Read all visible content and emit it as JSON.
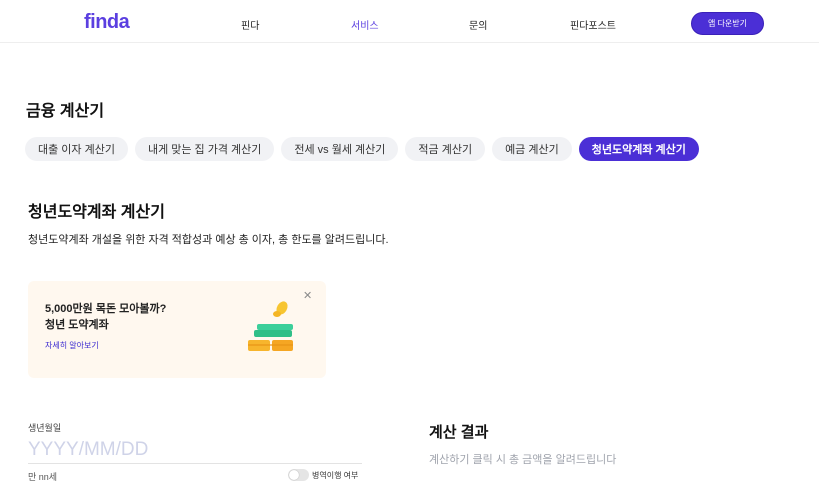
{
  "header": {
    "logo": "finda",
    "nav": [
      "핀다",
      "서비스",
      "문의",
      "핀다포스트"
    ],
    "active_nav": "서비스",
    "app_button": "앱 다운받기",
    "accent_color": "#4b2fd6"
  },
  "page": {
    "section_title": "금융 계산기",
    "chips": [
      {
        "label": "대출 이자 계산기",
        "active": false
      },
      {
        "label": "내게 맞는 집 가격 계산기",
        "active": false
      },
      {
        "label": "전세 vs 월세 계산기",
        "active": false
      },
      {
        "label": "적금 계산기",
        "active": false
      },
      {
        "label": "예금 계산기",
        "active": false
      },
      {
        "label": "청년도약계좌 계산기",
        "active": true
      }
    ],
    "calculator_title": "청년도약계좌 계산기",
    "calculator_desc": "청년도약계좌 개설을 위한 자격 적합성과 예상 총 이자, 총 한도를 알려드립니다."
  },
  "promo": {
    "line1": "5,000만원 목돈 모아볼까?",
    "line2": "청년 도약계좌",
    "link": "자세히 알아보기",
    "close_icon": "close-icon",
    "art_icon": "money-stack-icon"
  },
  "form": {
    "dob_label": "생년월일",
    "dob_placeholder": "YYYY/MM/DD",
    "age_text": "만 nn세",
    "military_toggle_label": "병역이행 여부"
  },
  "result": {
    "title": "계산 결과",
    "desc": "계산하기 클릭 시 총 금액을 알려드립니다"
  }
}
